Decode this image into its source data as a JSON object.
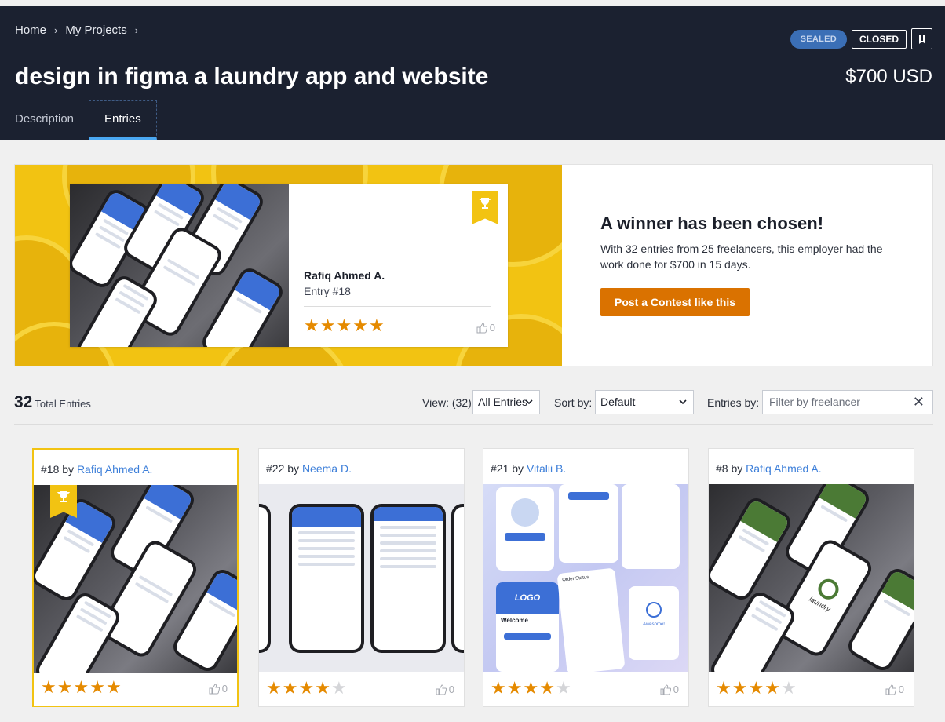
{
  "breadcrumb": {
    "home": "Home",
    "sep1": "›",
    "projects": "My Projects",
    "sep2": "›"
  },
  "status": {
    "sealed": "SEALED",
    "closed": "CLOSED"
  },
  "title": "design in figma a laundry app and website",
  "budget": "$700 USD",
  "tabs": [
    {
      "label": "Description"
    },
    {
      "label": "Entries"
    }
  ],
  "winner": {
    "name": "Rafiq Ahmed A.",
    "entry": "Entry #18",
    "rating": 5,
    "likes": "0",
    "headline": "A winner has been chosen!",
    "description": "With 32 entries from 25 freelancers, this employer had the work done for $700 in 15 days.",
    "cta": "Post a Contest like this"
  },
  "toolbar": {
    "total_count": "32",
    "total_label": "Total Entries",
    "view_label": "View: (32)",
    "view_value": "All Entries",
    "sort_label": "Sort by:",
    "sort_value": "Default",
    "entries_by_label": "Entries by:",
    "filter_placeholder": "Filter by freelancer"
  },
  "entries": [
    {
      "num": "#18",
      "by": "by",
      "freelancer": "Rafiq Ahmed A.",
      "rating": 5,
      "likes": "0",
      "winner": true
    },
    {
      "num": "#22",
      "by": "by",
      "freelancer": "Neema D.",
      "rating": 4,
      "likes": "0",
      "winner": false
    },
    {
      "num": "#21",
      "by": "by",
      "freelancer": "Vitalii B.",
      "rating": 4,
      "likes": "0",
      "winner": false
    },
    {
      "num": "#8",
      "by": "by",
      "freelancer": "Rafiq Ahmed A.",
      "rating": 4,
      "likes": "0",
      "winner": false
    }
  ],
  "mockup_text": {
    "logo": "LOGO",
    "welcome": "Welcome",
    "awesome": "Awesome!",
    "order_status": "Order Status",
    "brand": "laundry"
  },
  "colors": {
    "header_bg": "#1b2130",
    "accent_blue": "#4aa8f2",
    "link": "#3d7fd9",
    "cta": "#da7200",
    "banner_yellow": "#f2c312",
    "star": "#e58a00"
  },
  "icons": [
    "chevron-right-icon",
    "bookmark-icon",
    "trophy-icon",
    "thumbs-up-icon",
    "star-icon",
    "chevron-down-icon",
    "close-icon"
  ]
}
